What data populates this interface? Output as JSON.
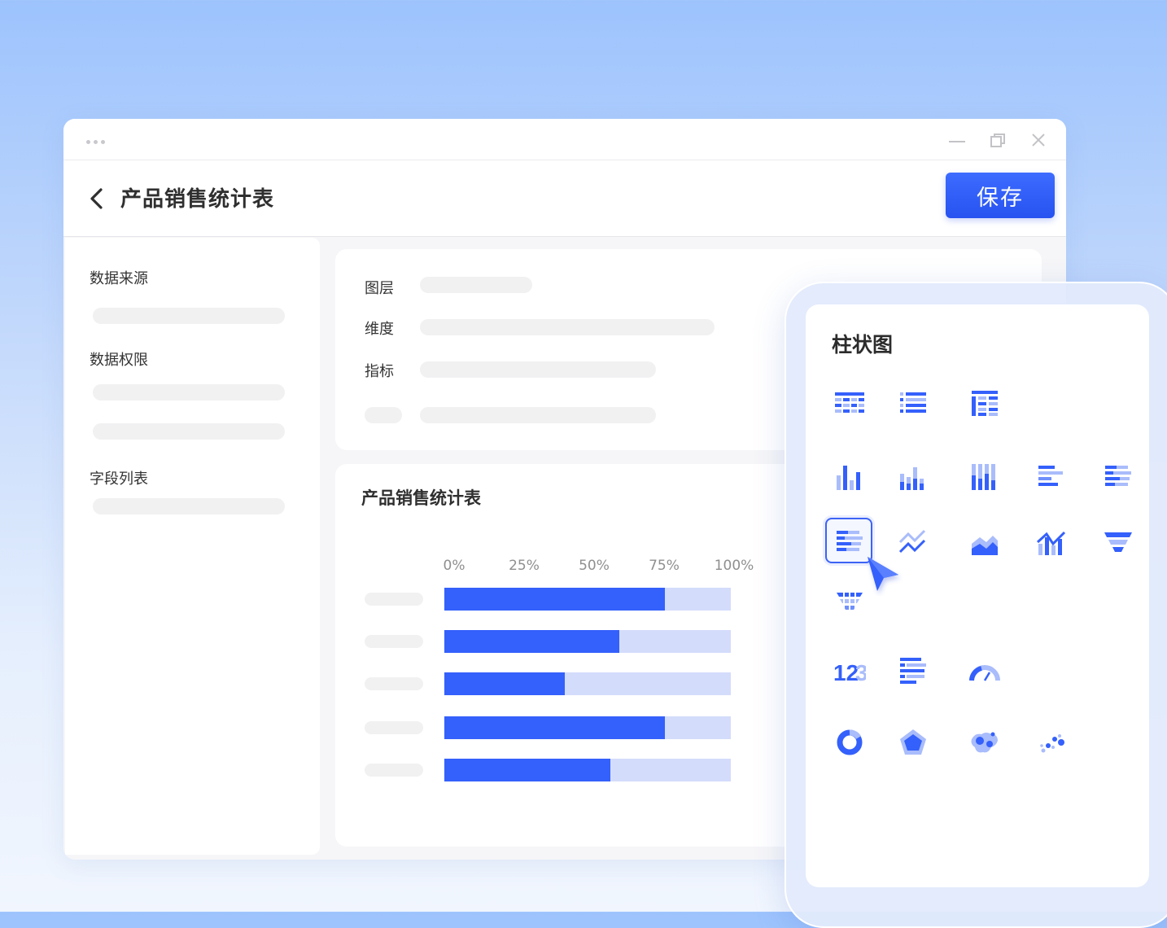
{
  "window": {
    "title": "产品销售统计表",
    "save_label": "保存"
  },
  "sidebar": {
    "sections": [
      {
        "label": "数据来源"
      },
      {
        "label": "数据权限"
      },
      {
        "label": "字段列表"
      }
    ]
  },
  "config": {
    "layer_label": "图层",
    "dimension_label": "维度",
    "metric_label": "指标"
  },
  "chart_data": {
    "type": "bar",
    "orientation": "horizontal",
    "title": "产品销售统计表",
    "xlabel": "",
    "ylabel": "",
    "x_ticks": [
      "0%",
      "25%",
      "50%",
      "75%",
      "100%"
    ],
    "xlim": [
      0,
      100
    ],
    "categories": [
      "",
      "",
      "",
      "",
      ""
    ],
    "values": [
      77,
      61,
      42,
      77,
      58
    ],
    "grid": false,
    "legend": "none",
    "colors": {
      "bar": "#3460fb",
      "track": "#d4dcfb"
    }
  },
  "chart_panel": {
    "title": "柱状图",
    "selected_icon": "stacked-horizontal-bar-icon",
    "icons": [
      "table-icon",
      "list-table-icon",
      "pivot-table-icon",
      "column-chart-icon",
      "stacked-column-icon",
      "percent-column-icon",
      "horizontal-bar-icon",
      "stacked-horizontal-bar-icon",
      "stacked-horizontal-bar-icon",
      "line-chart-icon",
      "area-chart-icon",
      "combo-chart-icon",
      "funnel-icon",
      "funnel-table-icon",
      "number-indicator-icon",
      "ranking-list-icon",
      "gauge-icon",
      "donut-chart-icon",
      "radar-chart-icon",
      "map-icon",
      "scatter-chart-icon"
    ]
  },
  "colors": {
    "accent": "#3460fb",
    "accent_light": "#d4dcfb"
  }
}
